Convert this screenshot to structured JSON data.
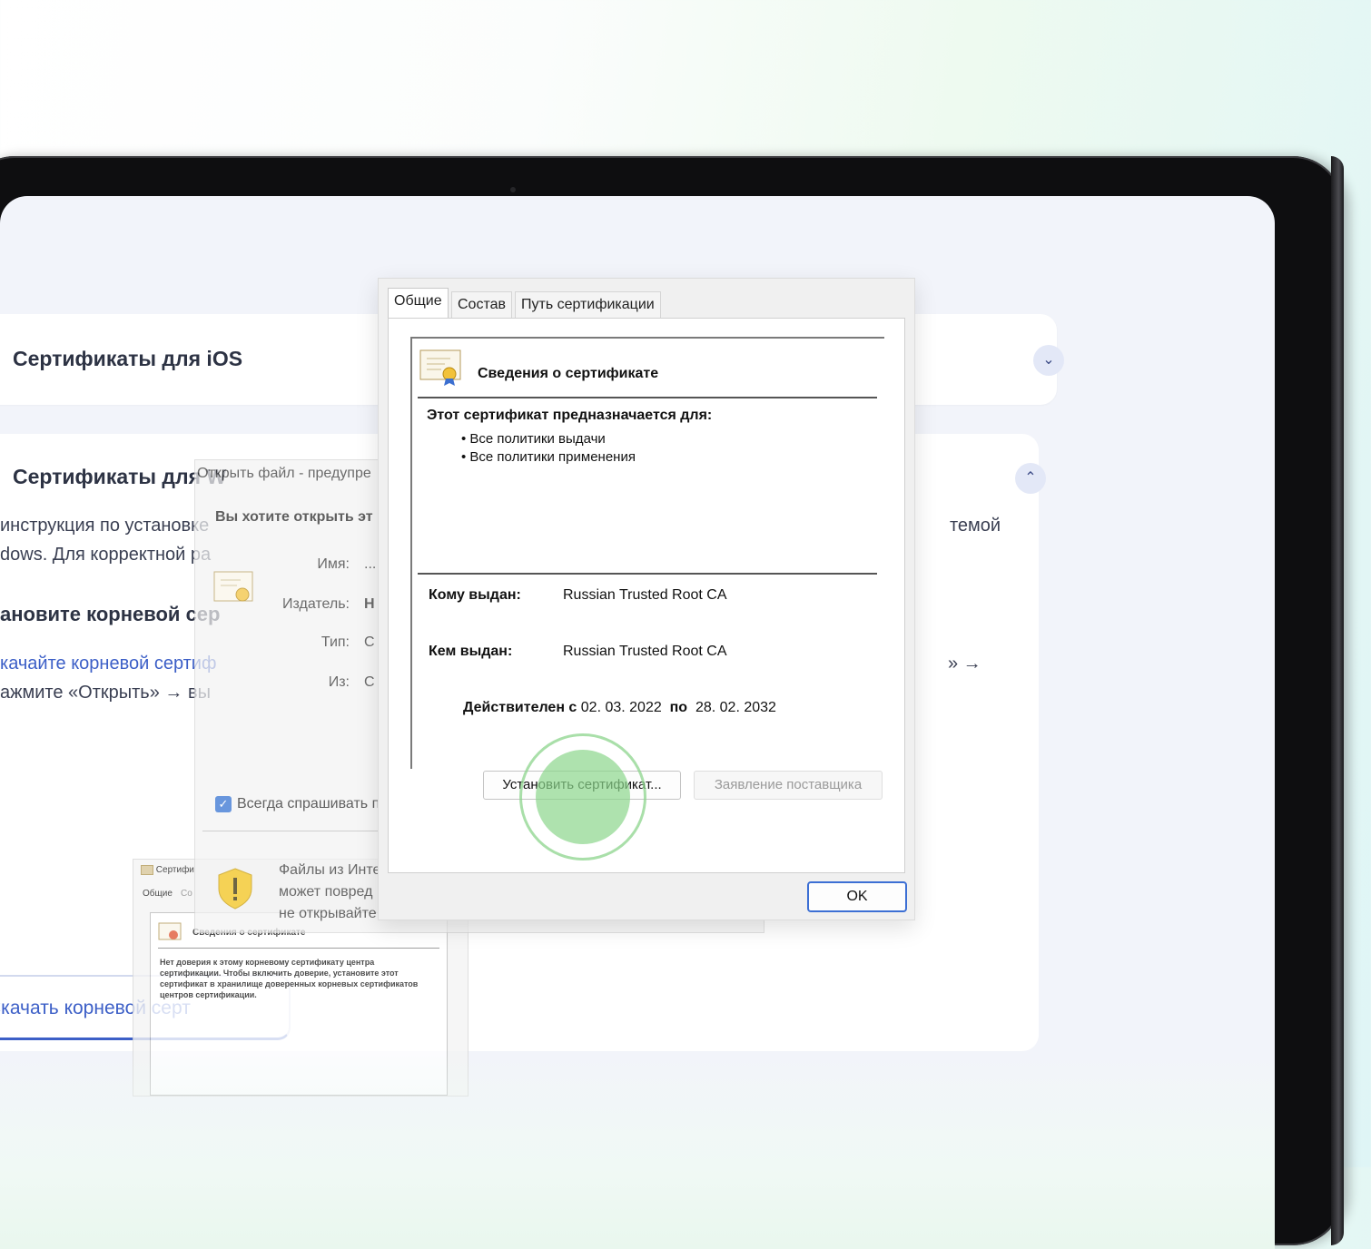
{
  "page": {
    "ios_card": {
      "title": "Сертификаты для iOS"
    },
    "windows_card": {
      "title": "Сертификаты для W",
      "line1": "инструкция по установке",
      "line1_tail": "темой",
      "line2": "dows. Для корректной ра",
      "step_heading": "ановите корневой сер",
      "step_link": "качайте корневой сертиф",
      "step_tail": "» →",
      "step_line2": "ажмите «Открыть» → вы",
      "download_button": "Скачать корневой серт"
    }
  },
  "warning_dialog": {
    "title": "Открыть файл - предупре",
    "question": "Вы хотите открыть эт",
    "fields": [
      {
        "label": "Имя:",
        "value": "..."
      },
      {
        "label": "Издатель:",
        "value": "Н"
      },
      {
        "label": "Тип:",
        "value": "С"
      },
      {
        "label": "Из:",
        "value": "С"
      }
    ],
    "checkbox_label": "Всегда спрашивать п",
    "footer_lines": [
      "Файлы из Инте",
      "может повред",
      "не открывайте"
    ]
  },
  "mini_preview": {
    "window_title": "Сертифи",
    "tabs": [
      "Общие",
      "Со"
    ],
    "heading": "Сведения о сертификате",
    "text": "Нет доверия к этому корневому сертификату центра сертификации. Чтобы включить доверие, установите этот сертификат в хранилище доверенных корневых сертификатов центров сертификации."
  },
  "cert_dialog": {
    "tabs": [
      "Общие",
      "Состав",
      "Путь сертификации"
    ],
    "info_title": "Сведения о сертификате",
    "purpose_label": "Этот сертификат предназначается для:",
    "purposes": [
      "Все политики выдачи",
      "Все политики применения"
    ],
    "issued_to_label": "Кому выдан:",
    "issued_to": "Russian Trusted Root CA",
    "issued_by_label": "Кем выдан:",
    "issued_by": "Russian Trusted Root CA",
    "valid_from_label": "Действителен с",
    "valid_from": "02. 03. 2022",
    "valid_to_label": "по",
    "valid_to": "28. 02. 2032",
    "install_button": "Установить сертификат...",
    "statement_button": "Заявление поставщика",
    "ok_button": "OK"
  },
  "colors": {
    "accent": "#3c5fc7",
    "title_text": "#2d3344",
    "click_highlight": "#8cd68c",
    "ok_border": "#3c6fd4"
  },
  "icons": {
    "certificate": "certificate-icon",
    "shield": "shield-warning-icon",
    "chevron_down": "chevron-down-icon",
    "chevron_up": "chevron-up-icon",
    "checkbox": "checkmark-icon"
  }
}
